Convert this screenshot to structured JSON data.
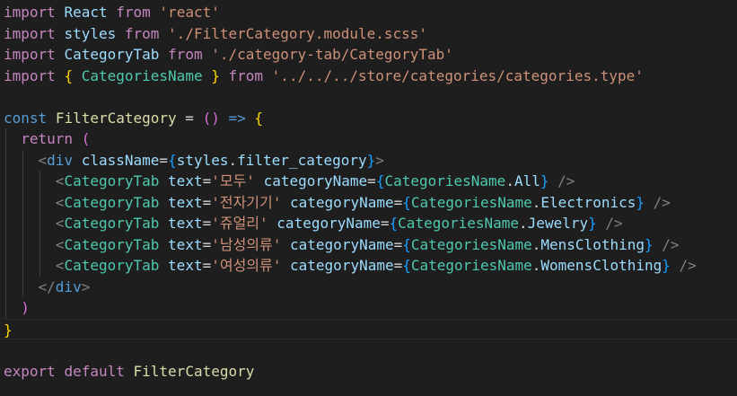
{
  "editor": {
    "language": "tsx",
    "theme_colors": {
      "background": "#1e1e1e",
      "keyword_control": "#c586c0",
      "keyword": "#569cd6",
      "identifier": "#9cdcfe",
      "type": "#4ec9b0",
      "string": "#ce9178",
      "function": "#dcdcaa",
      "punctuation": "#d4d4d4",
      "tag_bracket": "#808080",
      "bracket_paren": "#ffd700",
      "bracket_brace": "#da70d6",
      "bracket_jsx": "#179fff"
    }
  },
  "code_lines": [
    {
      "indent": 0,
      "tokens": [
        {
          "t": "import",
          "c": "#c586c0"
        },
        {
          "t": " ",
          "c": "#d4d4d4"
        },
        {
          "t": "React",
          "c": "#9cdcfe"
        },
        {
          "t": " ",
          "c": "#d4d4d4"
        },
        {
          "t": "from",
          "c": "#c586c0"
        },
        {
          "t": " ",
          "c": "#d4d4d4"
        },
        {
          "t": "'react'",
          "c": "#ce9178"
        }
      ]
    },
    {
      "indent": 0,
      "tokens": [
        {
          "t": "import",
          "c": "#c586c0"
        },
        {
          "t": " ",
          "c": "#d4d4d4"
        },
        {
          "t": "styles",
          "c": "#9cdcfe"
        },
        {
          "t": " ",
          "c": "#d4d4d4"
        },
        {
          "t": "from",
          "c": "#c586c0"
        },
        {
          "t": " ",
          "c": "#d4d4d4"
        },
        {
          "t": "'./FilterCategory.module.scss'",
          "c": "#ce9178"
        }
      ]
    },
    {
      "indent": 0,
      "tokens": [
        {
          "t": "import",
          "c": "#c586c0"
        },
        {
          "t": " ",
          "c": "#d4d4d4"
        },
        {
          "t": "CategoryTab",
          "c": "#9cdcfe"
        },
        {
          "t": " ",
          "c": "#d4d4d4"
        },
        {
          "t": "from",
          "c": "#c586c0"
        },
        {
          "t": " ",
          "c": "#d4d4d4"
        },
        {
          "t": "'./category-tab/CategoryTab'",
          "c": "#ce9178"
        }
      ]
    },
    {
      "indent": 0,
      "tokens": [
        {
          "t": "import",
          "c": "#c586c0"
        },
        {
          "t": " ",
          "c": "#d4d4d4"
        },
        {
          "t": "{",
          "c": "#ffd700"
        },
        {
          "t": " ",
          "c": "#d4d4d4"
        },
        {
          "t": "CategoriesName",
          "c": "#4ec9b0"
        },
        {
          "t": " ",
          "c": "#d4d4d4"
        },
        {
          "t": "}",
          "c": "#ffd700"
        },
        {
          "t": " ",
          "c": "#d4d4d4"
        },
        {
          "t": "from",
          "c": "#c586c0"
        },
        {
          "t": " ",
          "c": "#d4d4d4"
        },
        {
          "t": "'../../../store/categories/categories.type'",
          "c": "#ce9178"
        }
      ]
    },
    {
      "indent": 0,
      "tokens": []
    },
    {
      "indent": 0,
      "tokens": [
        {
          "t": "const",
          "c": "#569cd6"
        },
        {
          "t": " ",
          "c": "#d4d4d4"
        },
        {
          "t": "FilterCategory",
          "c": "#dcdcaa"
        },
        {
          "t": " = ",
          "c": "#d4d4d4"
        },
        {
          "t": "()",
          "c": "#da70d6"
        },
        {
          "t": " ",
          "c": "#d4d4d4"
        },
        {
          "t": "=>",
          "c": "#569cd6"
        },
        {
          "t": " ",
          "c": "#d4d4d4"
        },
        {
          "t": "{",
          "c": "#ffd700"
        }
      ]
    },
    {
      "indent": 1,
      "tokens": [
        {
          "t": "return",
          "c": "#c586c0"
        },
        {
          "t": " ",
          "c": "#d4d4d4"
        },
        {
          "t": "(",
          "c": "#da70d6"
        }
      ]
    },
    {
      "indent": 2,
      "tokens": [
        {
          "t": "<",
          "c": "#808080"
        },
        {
          "t": "div",
          "c": "#569cd6"
        },
        {
          "t": " ",
          "c": "#d4d4d4"
        },
        {
          "t": "className",
          "c": "#9cdcfe"
        },
        {
          "t": "=",
          "c": "#d4d4d4"
        },
        {
          "t": "{",
          "c": "#179fff"
        },
        {
          "t": "styles",
          "c": "#9cdcfe"
        },
        {
          "t": ".",
          "c": "#d4d4d4"
        },
        {
          "t": "filter_category",
          "c": "#9cdcfe"
        },
        {
          "t": "}",
          "c": "#179fff"
        },
        {
          "t": ">",
          "c": "#808080"
        }
      ]
    },
    {
      "indent": 3,
      "tokens": [
        {
          "t": "<",
          "c": "#808080"
        },
        {
          "t": "CategoryTab",
          "c": "#4ec9b0"
        },
        {
          "t": " ",
          "c": "#d4d4d4"
        },
        {
          "t": "text",
          "c": "#9cdcfe"
        },
        {
          "t": "=",
          "c": "#d4d4d4"
        },
        {
          "t": "'모두'",
          "c": "#ce9178"
        },
        {
          "t": " ",
          "c": "#d4d4d4"
        },
        {
          "t": "categoryName",
          "c": "#9cdcfe"
        },
        {
          "t": "=",
          "c": "#d4d4d4"
        },
        {
          "t": "{",
          "c": "#179fff"
        },
        {
          "t": "CategoriesName",
          "c": "#4ec9b0"
        },
        {
          "t": ".",
          "c": "#d4d4d4"
        },
        {
          "t": "All",
          "c": "#9cdcfe"
        },
        {
          "t": "}",
          "c": "#179fff"
        },
        {
          "t": " ",
          "c": "#d4d4d4"
        },
        {
          "t": "/>",
          "c": "#808080"
        }
      ]
    },
    {
      "indent": 3,
      "tokens": [
        {
          "t": "<",
          "c": "#808080"
        },
        {
          "t": "CategoryTab",
          "c": "#4ec9b0"
        },
        {
          "t": " ",
          "c": "#d4d4d4"
        },
        {
          "t": "text",
          "c": "#9cdcfe"
        },
        {
          "t": "=",
          "c": "#d4d4d4"
        },
        {
          "t": "'전자기기'",
          "c": "#ce9178"
        },
        {
          "t": " ",
          "c": "#d4d4d4"
        },
        {
          "t": "categoryName",
          "c": "#9cdcfe"
        },
        {
          "t": "=",
          "c": "#d4d4d4"
        },
        {
          "t": "{",
          "c": "#179fff"
        },
        {
          "t": "CategoriesName",
          "c": "#4ec9b0"
        },
        {
          "t": ".",
          "c": "#d4d4d4"
        },
        {
          "t": "Electronics",
          "c": "#9cdcfe"
        },
        {
          "t": "}",
          "c": "#179fff"
        },
        {
          "t": " ",
          "c": "#d4d4d4"
        },
        {
          "t": "/>",
          "c": "#808080"
        }
      ]
    },
    {
      "indent": 3,
      "tokens": [
        {
          "t": "<",
          "c": "#808080"
        },
        {
          "t": "CategoryTab",
          "c": "#4ec9b0"
        },
        {
          "t": " ",
          "c": "#d4d4d4"
        },
        {
          "t": "text",
          "c": "#9cdcfe"
        },
        {
          "t": "=",
          "c": "#d4d4d4"
        },
        {
          "t": "'쥬얼리'",
          "c": "#ce9178"
        },
        {
          "t": " ",
          "c": "#d4d4d4"
        },
        {
          "t": "categoryName",
          "c": "#9cdcfe"
        },
        {
          "t": "=",
          "c": "#d4d4d4"
        },
        {
          "t": "{",
          "c": "#179fff"
        },
        {
          "t": "CategoriesName",
          "c": "#4ec9b0"
        },
        {
          "t": ".",
          "c": "#d4d4d4"
        },
        {
          "t": "Jewelry",
          "c": "#9cdcfe"
        },
        {
          "t": "}",
          "c": "#179fff"
        },
        {
          "t": " ",
          "c": "#d4d4d4"
        },
        {
          "t": "/>",
          "c": "#808080"
        }
      ]
    },
    {
      "indent": 3,
      "tokens": [
        {
          "t": "<",
          "c": "#808080"
        },
        {
          "t": "CategoryTab",
          "c": "#4ec9b0"
        },
        {
          "t": " ",
          "c": "#d4d4d4"
        },
        {
          "t": "text",
          "c": "#9cdcfe"
        },
        {
          "t": "=",
          "c": "#d4d4d4"
        },
        {
          "t": "'남성의류'",
          "c": "#ce9178"
        },
        {
          "t": " ",
          "c": "#d4d4d4"
        },
        {
          "t": "categoryName",
          "c": "#9cdcfe"
        },
        {
          "t": "=",
          "c": "#d4d4d4"
        },
        {
          "t": "{",
          "c": "#179fff"
        },
        {
          "t": "CategoriesName",
          "c": "#4ec9b0"
        },
        {
          "t": ".",
          "c": "#d4d4d4"
        },
        {
          "t": "MensClothing",
          "c": "#9cdcfe"
        },
        {
          "t": "}",
          "c": "#179fff"
        },
        {
          "t": " ",
          "c": "#d4d4d4"
        },
        {
          "t": "/>",
          "c": "#808080"
        }
      ]
    },
    {
      "indent": 3,
      "tokens": [
        {
          "t": "<",
          "c": "#808080"
        },
        {
          "t": "CategoryTab",
          "c": "#4ec9b0"
        },
        {
          "t": " ",
          "c": "#d4d4d4"
        },
        {
          "t": "text",
          "c": "#9cdcfe"
        },
        {
          "t": "=",
          "c": "#d4d4d4"
        },
        {
          "t": "'여성의류'",
          "c": "#ce9178"
        },
        {
          "t": " ",
          "c": "#d4d4d4"
        },
        {
          "t": "categoryName",
          "c": "#9cdcfe"
        },
        {
          "t": "=",
          "c": "#d4d4d4"
        },
        {
          "t": "{",
          "c": "#179fff"
        },
        {
          "t": "CategoriesName",
          "c": "#4ec9b0"
        },
        {
          "t": ".",
          "c": "#d4d4d4"
        },
        {
          "t": "WomensClothing",
          "c": "#9cdcfe"
        },
        {
          "t": "}",
          "c": "#179fff"
        },
        {
          "t": " ",
          "c": "#d4d4d4"
        },
        {
          "t": "/>",
          "c": "#808080"
        }
      ]
    },
    {
      "indent": 2,
      "tokens": [
        {
          "t": "</",
          "c": "#808080"
        },
        {
          "t": "div",
          "c": "#569cd6"
        },
        {
          "t": ">",
          "c": "#808080"
        }
      ]
    },
    {
      "indent": 1,
      "tokens": [
        {
          "t": ")",
          "c": "#da70d6"
        }
      ]
    },
    {
      "indent": 0,
      "current": true,
      "tokens": [
        {
          "t": "}",
          "c": "#ffd700"
        }
      ]
    },
    {
      "indent": 0,
      "tokens": []
    },
    {
      "indent": 0,
      "tokens": [
        {
          "t": "export",
          "c": "#c586c0"
        },
        {
          "t": " ",
          "c": "#d4d4d4"
        },
        {
          "t": "default",
          "c": "#c586c0"
        },
        {
          "t": " ",
          "c": "#d4d4d4"
        },
        {
          "t": "FilterCategory",
          "c": "#dcdcaa"
        }
      ]
    }
  ]
}
